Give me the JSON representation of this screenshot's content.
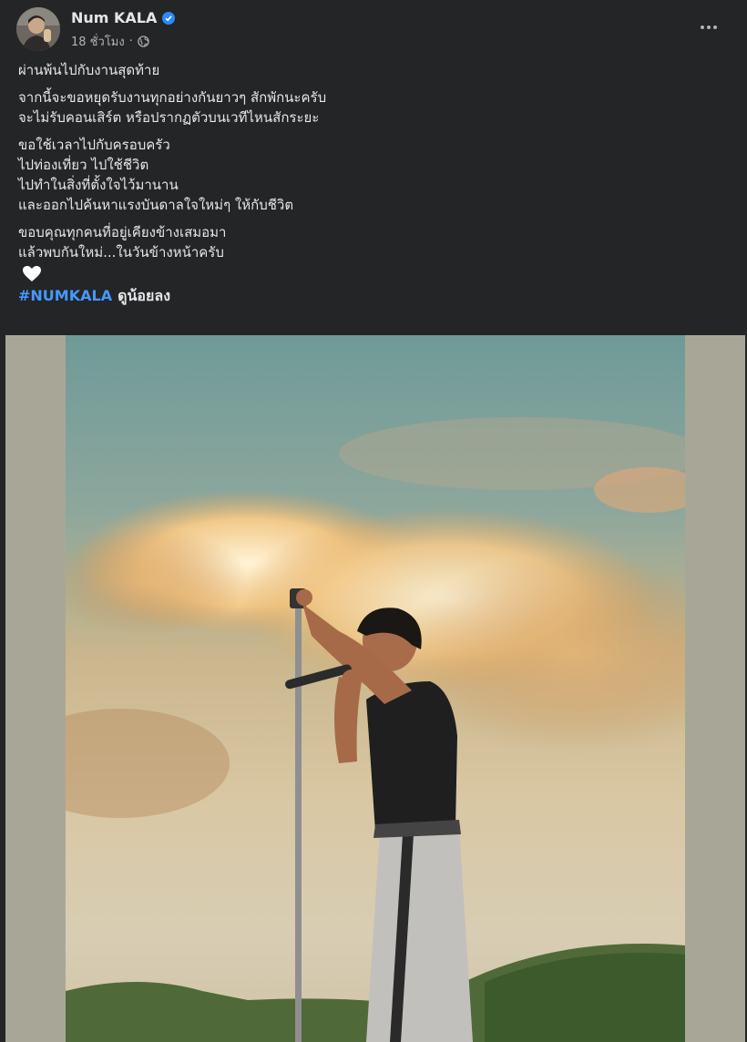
{
  "post": {
    "author": "Num KALA",
    "time": "18 ชั่วโมง",
    "separator": "·",
    "paragraphs": [
      [
        "ผ่านพ้นไปกับงานสุดท้าย"
      ],
      [
        "จากนี้จะขอหยุดรับงานทุกอย่างกันยาวๆ สักพักนะครับ",
        "จะไม่รับคอนเสิร์ต หรือปรากฏตัวบนเวทีไหนสักระยะ"
      ],
      [
        "ขอใช้เวลาไปกับครอบครัว",
        "ไปท่องเที่ยว ไปใช้ชีวิต",
        "ไปทำในสิ่งที่ตั้งใจไว้มานาน",
        "และออกไปค้นหาแรงบันดาลใจใหม่ๆ ให้กับชีวิต"
      ],
      [
        "ขอบคุณทุกคนที่อยู่เคียงข้างเสมอมา",
        "แล้วพบกันใหม่...ในวันข้างหน้าครับ"
      ]
    ],
    "heart": "🤍",
    "hashtag": "#NUMKALA",
    "tag_text": "ดูน้อยลง"
  },
  "colors": {
    "background": "#242526",
    "text": "#e4e6eb",
    "secondary": "#b0b3b8",
    "hashtag": "#4599ff",
    "verified": "#2d88ff",
    "media_side": "#a8a797"
  },
  "icons": [
    "verified-badge-icon",
    "globe-icon",
    "more-options-icon",
    "heart-icon"
  ]
}
